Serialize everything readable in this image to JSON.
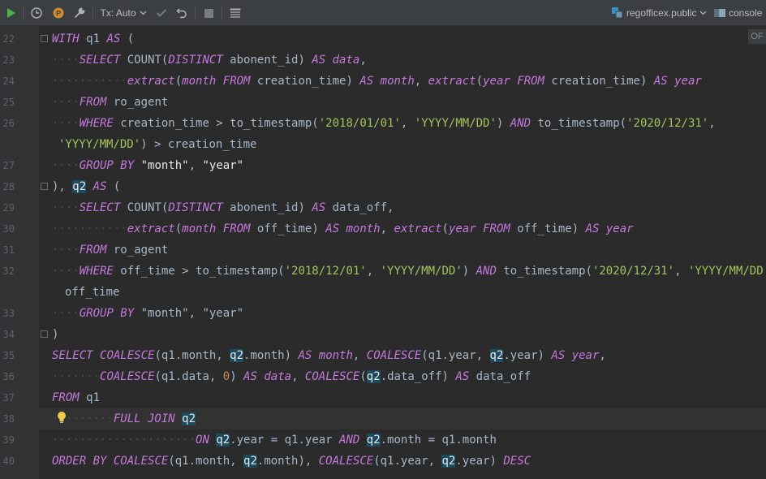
{
  "toolbar": {
    "run_icon": "play-icon",
    "history_icon": "clock-icon",
    "pin_icon": "p-icon",
    "settings_icon": "wrench-icon",
    "tx_label": "Tx: Auto",
    "commit_icon": "check-icon",
    "rollback_icon": "undo-icon",
    "stop_icon": "stop-icon",
    "output_icon": "table-icon",
    "datasource_label": "regofficex.public",
    "console_label": "console",
    "accent": "#4caf50"
  },
  "editor": {
    "right_label": "OF",
    "line_numbers": [
      "22",
      "23",
      "24",
      "25",
      "26",
      "",
      "27",
      "28",
      "29",
      "30",
      "31",
      "32",
      "",
      "33",
      "34",
      "35",
      "36",
      "37",
      "38",
      "39",
      "40"
    ]
  }
}
